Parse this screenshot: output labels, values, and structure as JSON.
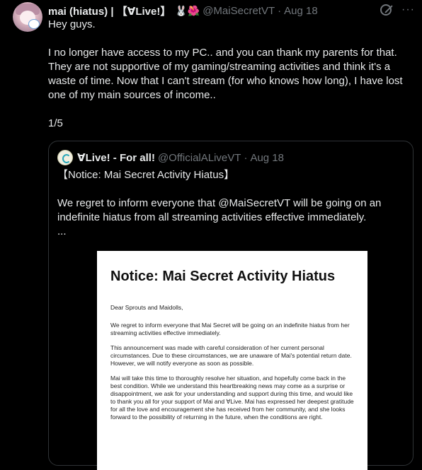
{
  "tweet": {
    "author_name": "mai (hiatus) | 【∀Live!】",
    "author_emoji": "🐰🌺",
    "handle": "@MaiSecretVT",
    "separator": "·",
    "time": "Aug 18",
    "more_glyph": "···",
    "paragraphs": [
      "Hey guys.",
      "I no longer have access to my PC.. and you can thank my parents for that. They are not supportive of my gaming/streaming activities and think it's a waste of time. Now that I can't stream (for who knows how long), I have lost one of my main sources of income..",
      "1/5"
    ]
  },
  "quote": {
    "author_name": "∀Live! - For all!",
    "handle": "@OfficialALiveVT",
    "separator": "·",
    "time": "Aug 18",
    "title_line": "【Notice: Mai Secret Activity Hiatus】",
    "body": "We regret to inform everyone that @MaiSecretVT will be going on an indefinite hiatus from all streaming activities effective immediately.",
    "ellipsis": "...",
    "doc": {
      "title": "Notice: Mai Secret Activity Hiatus",
      "paragraphs": [
        "Dear Sprouts and Maidolls,",
        "We regret to inform everyone that Mai Secret will be going on an indefinite hiatus from her streaming activities effective immediately.",
        "This announcement was made with careful consideration of her current personal circumstances. Due to these circumstances, we are unaware of Mai's potential return date. However, we will notify everyone as soon as possible.",
        "Mai will take this time to thoroughly resolve her situation, and hopefully come back in the best condition. While we understand this heartbreaking news may come as a surprise or disappointment, we ask for your understanding and support during this time, and would like to thank you all for your support of Mai and ∀Live. Mai has expressed her deepest gratitude for all the love and encouragement she has received from her community, and she looks forward to the possibility of returning in the future, when the conditions are right."
      ]
    }
  }
}
